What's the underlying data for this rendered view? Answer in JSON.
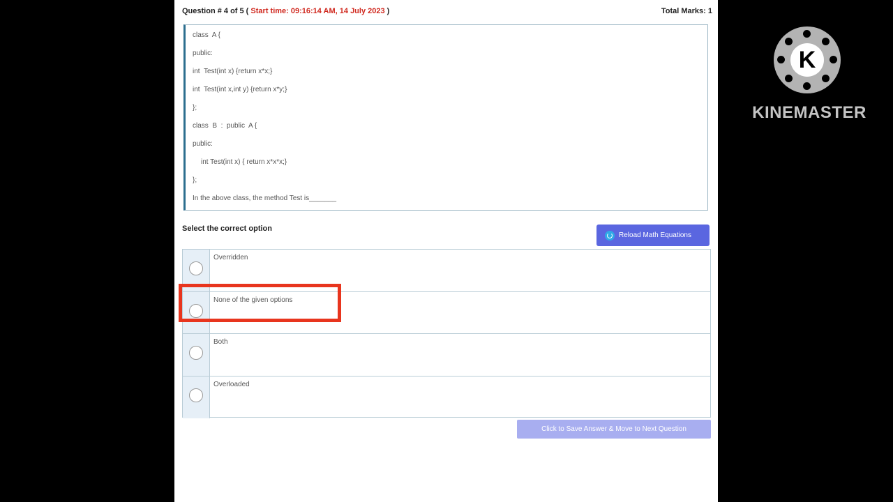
{
  "header": {
    "question_prefix": "Question # 4 of 5 (",
    "start_time": "Start time: 09:16:14 AM, 14 July 2023",
    "question_suffix": ")",
    "total_marks": "Total Marks: 1"
  },
  "question": {
    "lines": [
      "class  A {",
      "public:",
      "int  Test(int x) {return x*x;}",
      "int  Test(int x,int y) {return x*y;}",
      "};",
      "class  B  :  public  A {",
      "public:",
      "int Test(int x) { return x*x*x;}",
      "};",
      "In the above class, the method Test is_______"
    ]
  },
  "select_label": "Select the correct option",
  "reload_button": "Reload Math Equations",
  "options": [
    "Overridden",
    "None of the given options",
    "Both",
    "Overloaded"
  ],
  "next_button": "Click to Save Answer & Move to Next Question",
  "watermark": "KINEMASTER",
  "colors": {
    "start_time": "#d0281e",
    "reload_button_bg": "#5a66e0",
    "next_button_bg": "#a8aef0",
    "highlight_box": "#e8351e"
  }
}
